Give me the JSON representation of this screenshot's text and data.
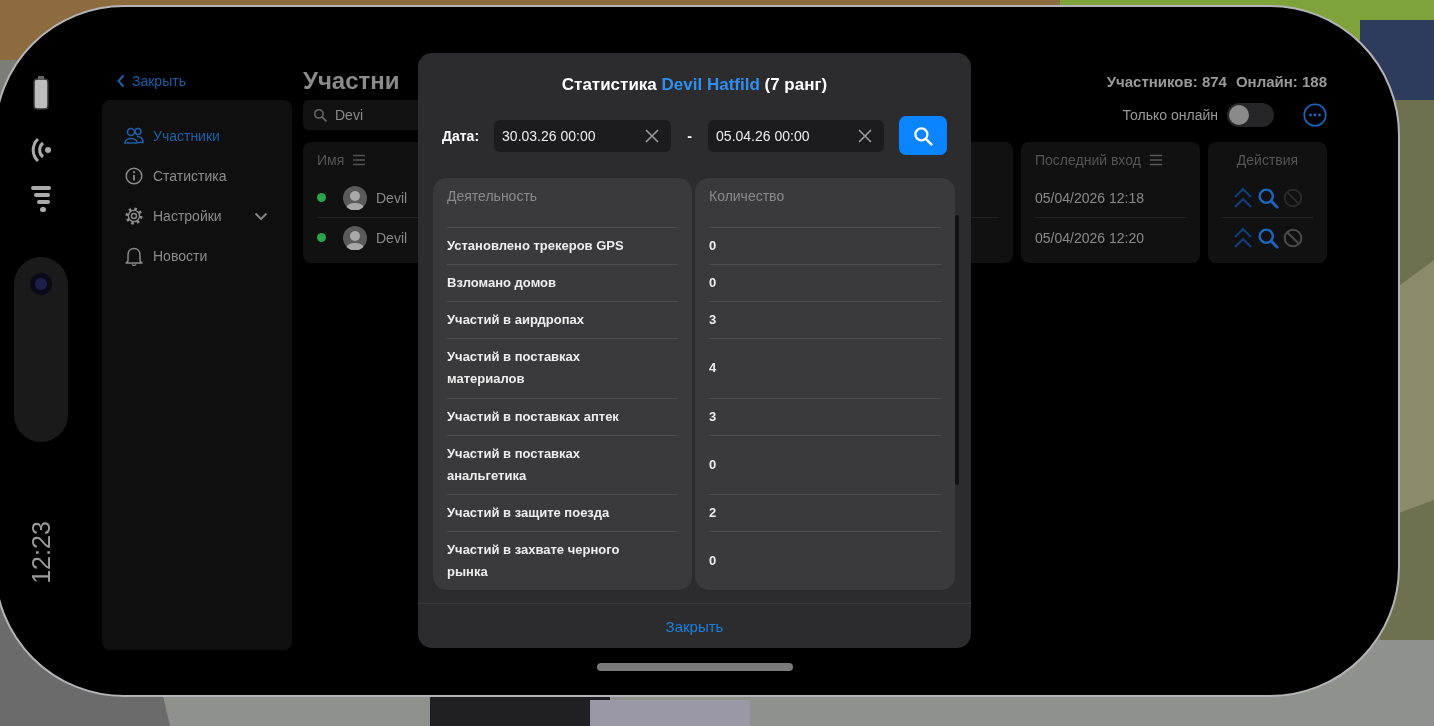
{
  "phone": {
    "time": "12:23"
  },
  "back_link": "Закрыть",
  "title": "Участни",
  "stats": [
    "Участников: 874",
    "Онлайн: 188"
  ],
  "sidebar": {
    "items": [
      {
        "label": "Участники",
        "kind": "members",
        "selected": true
      },
      {
        "label": "Статистика",
        "kind": "info",
        "selected": false
      },
      {
        "label": "Настройки",
        "kind": "settings",
        "selected": false,
        "expanded": false
      },
      {
        "label": "Новости",
        "kind": "news",
        "selected": false
      }
    ]
  },
  "search": {
    "value": "Devi"
  },
  "online_only": {
    "label": "Только онлайн",
    "on": false
  },
  "table": {
    "columns": [
      "Имя",
      "Последний вход",
      "Действия"
    ],
    "rows": [
      {
        "name": "Devil",
        "online": true,
        "last_login": "05/04/2026 12:18",
        "ban_disabled": true
      },
      {
        "name": "Devil",
        "online": true,
        "last_login": "05/04/2026 12:20",
        "ban_disabled": false
      }
    ]
  },
  "modal": {
    "title": "Статистика",
    "player": "Devil Hatfild",
    "rank": "(7 ранг)",
    "date_label": "Дата:",
    "date_from": "30.03.26 00:00",
    "separator": "-",
    "date_to": "05.04.26 00:00",
    "columns": [
      "Деятельность",
      "Количество"
    ],
    "rows": [
      {
        "activity": "Установлено трекеров GPS",
        "count": "0"
      },
      {
        "activity": "Взломано домов",
        "count": "0"
      },
      {
        "activity": "Участий в аирдропах",
        "count": "3"
      },
      {
        "activity": "Участий в поставках материалов",
        "count": "4"
      },
      {
        "activity": "Участий в поставках аптек",
        "count": "3"
      },
      {
        "activity": "Участий в поставках анальгетика",
        "count": "0"
      },
      {
        "activity": "Участий в защите поезда",
        "count": "2"
      },
      {
        "activity": "Участий в захвате черного рынка",
        "count": "0"
      }
    ],
    "close": "Закрыть"
  }
}
